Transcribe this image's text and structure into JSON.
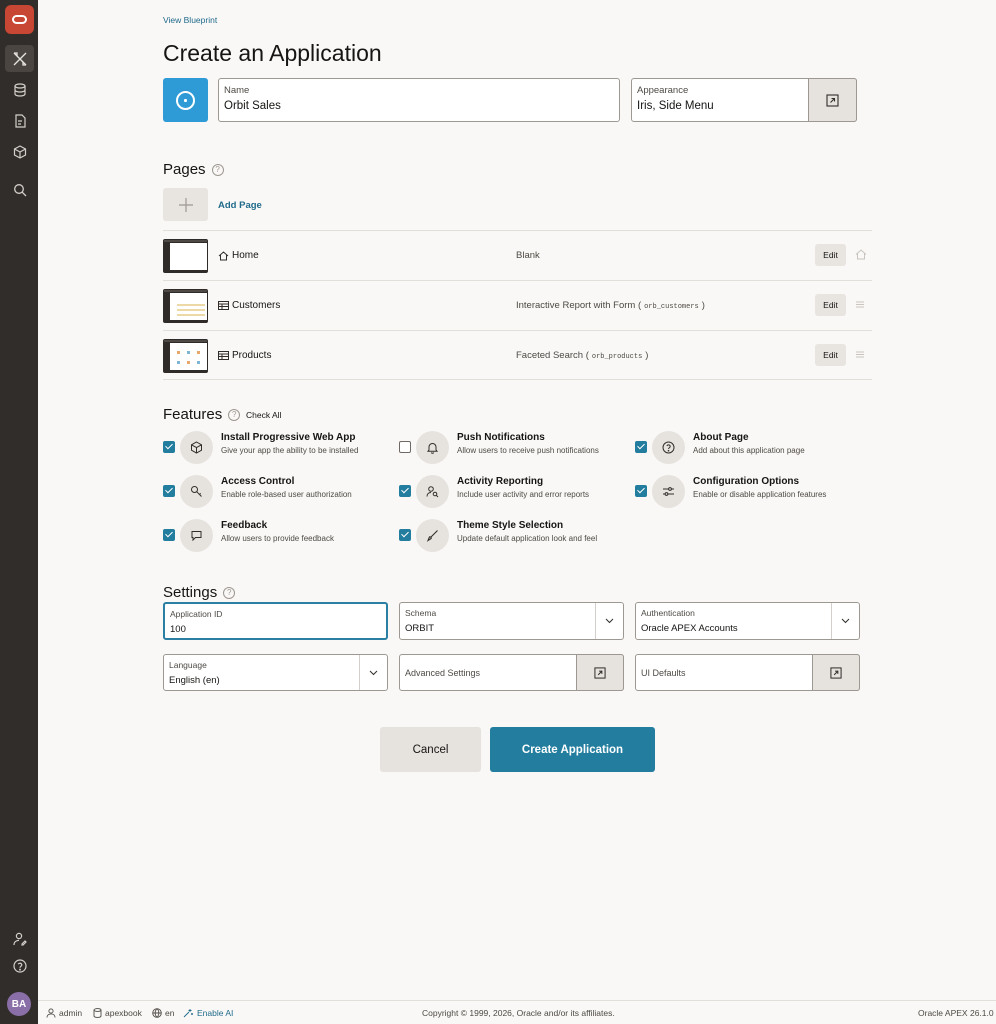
{
  "nav": {
    "items": [
      "app-builder",
      "sql-workshop",
      "team-development",
      "gallery",
      "search"
    ],
    "bottom": [
      "admin",
      "help"
    ],
    "avatar": "BA"
  },
  "header": {
    "view_blueprint": "View Blueprint",
    "title": "Create an Application"
  },
  "app": {
    "icon": "chart-icon",
    "icon_color": "#2e9bd6",
    "name_label": "Name",
    "name_value": "Orbit Sales",
    "appearance_label": "Appearance",
    "appearance_value": "Iris, Side Menu"
  },
  "pages": {
    "title": "Pages",
    "help": "?",
    "add_label": "Add Page",
    "rows": [
      {
        "name": "Home",
        "type": "Blank",
        "source": "",
        "edit": "Edit"
      },
      {
        "name": "Customers",
        "type": "Interactive Report with Form (",
        "source": "orb_customers",
        "close": ")",
        "edit": "Edit"
      },
      {
        "name": "Products",
        "type": "Faceted Search (",
        "source": "orb_products",
        "close": ")",
        "edit": "Edit"
      }
    ]
  },
  "features": {
    "title": "Features",
    "help": "?",
    "check_all": "Check All",
    "items": [
      {
        "title": "Install Progressive Web App",
        "desc": "Give your app the ability to be installed",
        "checked": true,
        "icon": "box-icon"
      },
      {
        "title": "Push Notifications",
        "desc": "Allow users to receive push notifications",
        "checked": false,
        "icon": "bell-icon"
      },
      {
        "title": "About Page",
        "desc": "Add about this application page",
        "checked": true,
        "icon": "question-icon"
      },
      {
        "title": "Access Control",
        "desc": "Enable role-based user authorization",
        "checked": true,
        "icon": "key-icon"
      },
      {
        "title": "Activity Reporting",
        "desc": "Include user activity and error reports",
        "checked": true,
        "icon": "user-search-icon"
      },
      {
        "title": "Configuration Options",
        "desc": "Enable or disable application features",
        "checked": true,
        "icon": "sliders-icon"
      },
      {
        "title": "Feedback",
        "desc": "Allow users to provide feedback",
        "checked": true,
        "icon": "comment-icon"
      },
      {
        "title": "Theme Style Selection",
        "desc": "Update default application look and feel",
        "checked": true,
        "icon": "brush-icon"
      }
    ]
  },
  "settings": {
    "title": "Settings",
    "help": "?",
    "app_id_label": "Application ID",
    "app_id_value": "100",
    "schema_label": "Schema",
    "schema_value": "ORBIT",
    "auth_label": "Authentication",
    "auth_value": "Oracle APEX Accounts",
    "language_label": "Language",
    "language_value": "English (en)",
    "advanced_label": "Advanced Settings",
    "ui_defaults_label": "UI Defaults"
  },
  "actions": {
    "cancel": "Cancel",
    "create": "Create Application",
    "primary_color": "#227d9e"
  },
  "footer": {
    "user": "admin",
    "workspace": "apexbook",
    "lang": "en",
    "enable_ai": "Enable AI",
    "copyright": "Copyright © 1999, 2026, Oracle and/or its affiliates.",
    "version": "Oracle APEX 26.1.0"
  }
}
